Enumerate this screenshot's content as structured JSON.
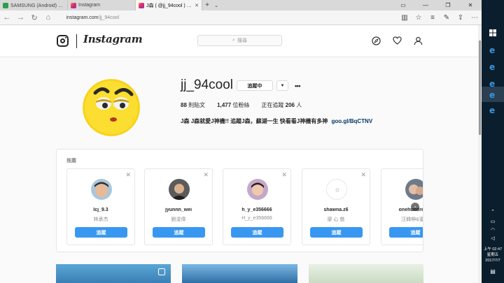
{
  "browser": {
    "tabs": [
      {
        "label": "SAMSUNG (Android) - J枚序",
        "favicon_color": "#2e9e4e",
        "active": false
      },
      {
        "label": "Instagram",
        "favicon_color": "#d62976",
        "active": false
      },
      {
        "label": "J森 ( @jj_94cool ) • Inst",
        "favicon_color": "#d62976",
        "active": true
      }
    ],
    "url": "instagram.com",
    "url_path": "/jj_94cool"
  },
  "instagram": {
    "wordmark": "Instagram",
    "search_placeholder": "搜尋",
    "profile": {
      "username": "jj_94cool",
      "follow_label": "追蹤中",
      "posts_count": "88",
      "posts_label": "則貼文",
      "followers_count": "1,477",
      "followers_label": "位粉絲",
      "following_prefix": "正在追蹤",
      "following_count": "206",
      "following_suffix": "人",
      "bio_name": "J森",
      "bio_text": "J森就愛J神機!! 追蹤J森，蘇湖一生 快看看J神機有多神",
      "bio_link": "goo.gl/BqCTNV"
    },
    "suggestions": {
      "title": "推薦",
      "follow_button": "追蹤",
      "items": [
        {
          "username": "lcj_9.3",
          "subtitle": "林承杰"
        },
        {
          "username": "jyunnn_wei",
          "subtitle": "劉浚偉"
        },
        {
          "username": "h_y_e356666",
          "subtitle": "H_y_e356666"
        },
        {
          "username": "shawna.z6",
          "subtitle": "廖 心 慈"
        },
        {
          "username": "onehundredm",
          "subtitle": "汪韓伸&蜜莉"
        }
      ]
    }
  },
  "taskbar": {
    "clock_period": "上午 02:47",
    "clock_day": "星期五",
    "clock_date": "2017/7/7"
  },
  "colors": {
    "accent_blue": "#3897f0",
    "link_blue": "#003569",
    "taskbar": "#0b1e2d"
  }
}
